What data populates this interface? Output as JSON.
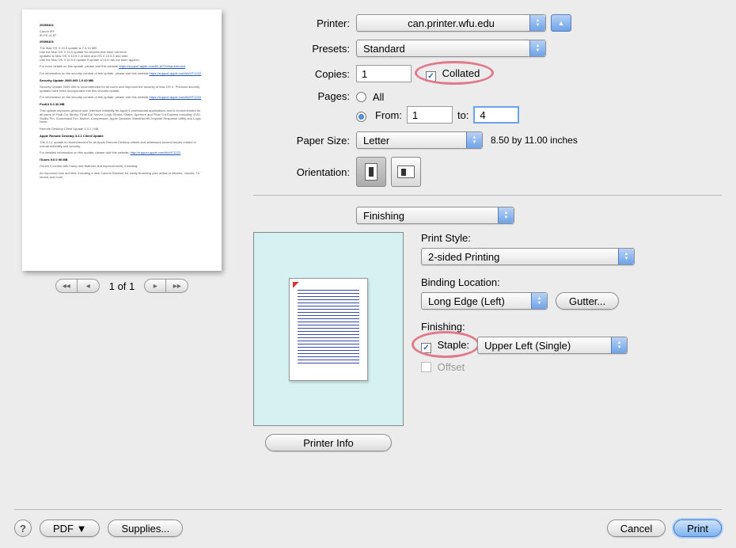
{
  "printer": {
    "label": "Printer:",
    "value": "can.printer.wfu.edu"
  },
  "presets": {
    "label": "Presets:",
    "value": "Standard"
  },
  "copies": {
    "label": "Copies:",
    "value": "1",
    "collated_label": "Collated",
    "collated": true
  },
  "pages": {
    "label": "Pages:",
    "all_label": "All",
    "from_label": "From:",
    "to_label": "to:",
    "from": "1",
    "to": "4",
    "mode": "from"
  },
  "paper": {
    "label": "Paper Size:",
    "value": "Letter",
    "dims": "8.50 by 11.00 inches"
  },
  "orientation": {
    "label": "Orientation:"
  },
  "section_menu": "Finishing",
  "finishing": {
    "print_style_label": "Print Style:",
    "print_style": "2-sided Printing",
    "binding_label": "Binding Location:",
    "binding": "Long Edge (Left)",
    "gutter_btn": "Gutter...",
    "finishing_label": "Finishing:",
    "staple_label": "Staple:",
    "staple_value": "Upper Left (Single)",
    "offset_label": "Offset"
  },
  "printer_info_btn": "Printer Info",
  "pager": "1 of 1",
  "footer": {
    "pdf": "PDF ▼",
    "supplies": "Supplies...",
    "cancel": "Cancel",
    "print": "Print"
  }
}
